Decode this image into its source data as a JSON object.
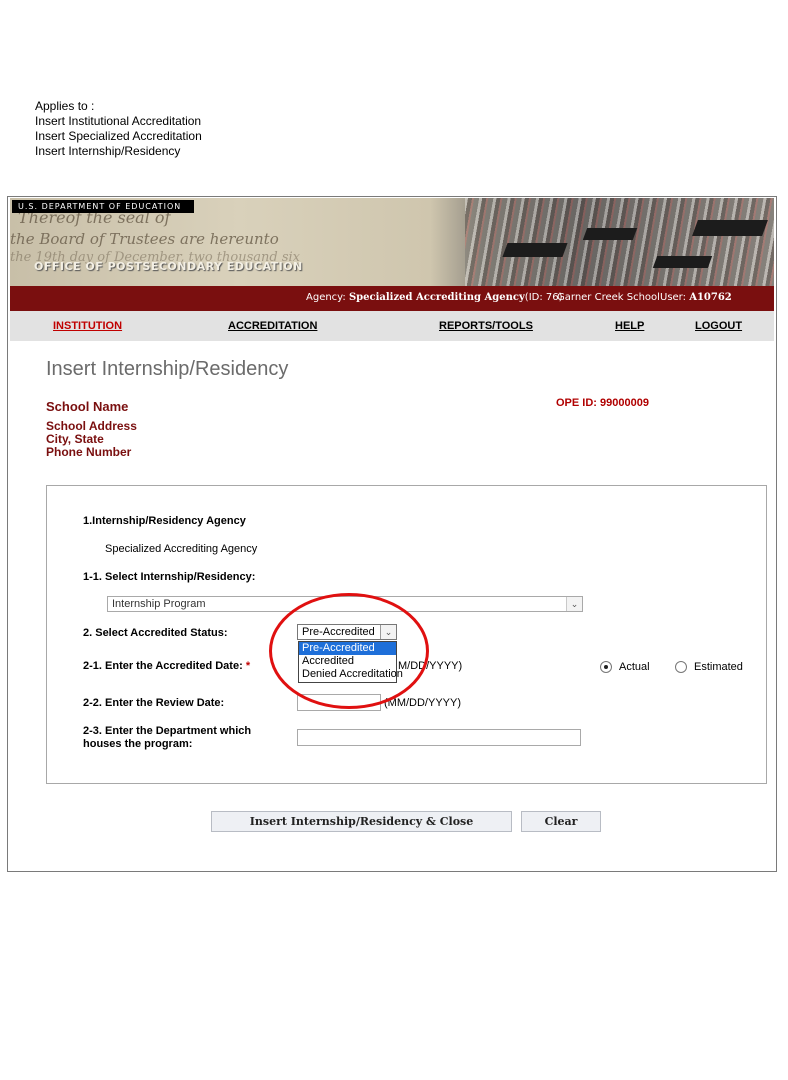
{
  "applies": {
    "title": "Applies to :",
    "items": [
      "Insert Institutional Accreditation",
      "Insert Specialized Accreditation",
      "Insert Internship/Residency"
    ]
  },
  "banner": {
    "department": "U.S. DEPARTMENT OF EDUCATION",
    "office": "OFFICE OF POSTSECONDARY EDUCATION",
    "script_lines": [
      "Thereof the seal of",
      "the Board of Trustees are hereunto",
      "the 19th day of December, two thousand six"
    ]
  },
  "infobar": {
    "agency_label": "Agency:",
    "agency_name": "Specialized Accrediting Agency",
    "agency_id": "(ID: 76)",
    "school": "Garner Creek School",
    "user_label": "User:",
    "user_id": "A10762"
  },
  "nav": {
    "institution": "INSTITUTION",
    "accreditation": "ACCREDITATION",
    "reports": "REPORTS/TOOLS",
    "help": "HELP",
    "logout": "LOGOUT"
  },
  "page": {
    "title": "Insert Internship/Residency",
    "school_name": "School Name",
    "school_address": "School Address",
    "city_state": "City, State",
    "phone": "Phone Number",
    "ope_id": "OPE ID: 99000009"
  },
  "form": {
    "agency_heading": "1.Internship/Residency Agency",
    "agency_value": "Specialized Accrediting Agency",
    "select_program_label": "1-1. Select Internship/Residency:",
    "program_selected": "Internship Program",
    "status_label": "2. Select Accredited Status:",
    "status_selected": "Pre-Accredited",
    "status_options": [
      "Pre-Accredited",
      "Accredited",
      "Denied Accreditation"
    ],
    "accredited_date_label": "2-1. Enter the Accredited Date:",
    "required_mark": "*",
    "date_format_partial": "M/DD/YYYY)",
    "radio_actual": "Actual",
    "radio_estimated": "Estimated",
    "review_date_label": "2-2. Enter the Review Date:",
    "review_date_format": "(MM/DD/YYYY)",
    "department_label_1": "2-3. Enter the Department which",
    "department_label_2": "houses the program:"
  },
  "buttons": {
    "insert": "Insert Internship/Residency & Close",
    "clear": "Clear"
  },
  "colors": {
    "brand_red": "#7a0f0f",
    "nav_active": "#c00000",
    "annotation_circle": "#e01010",
    "highlight": "#1e6fd9"
  }
}
